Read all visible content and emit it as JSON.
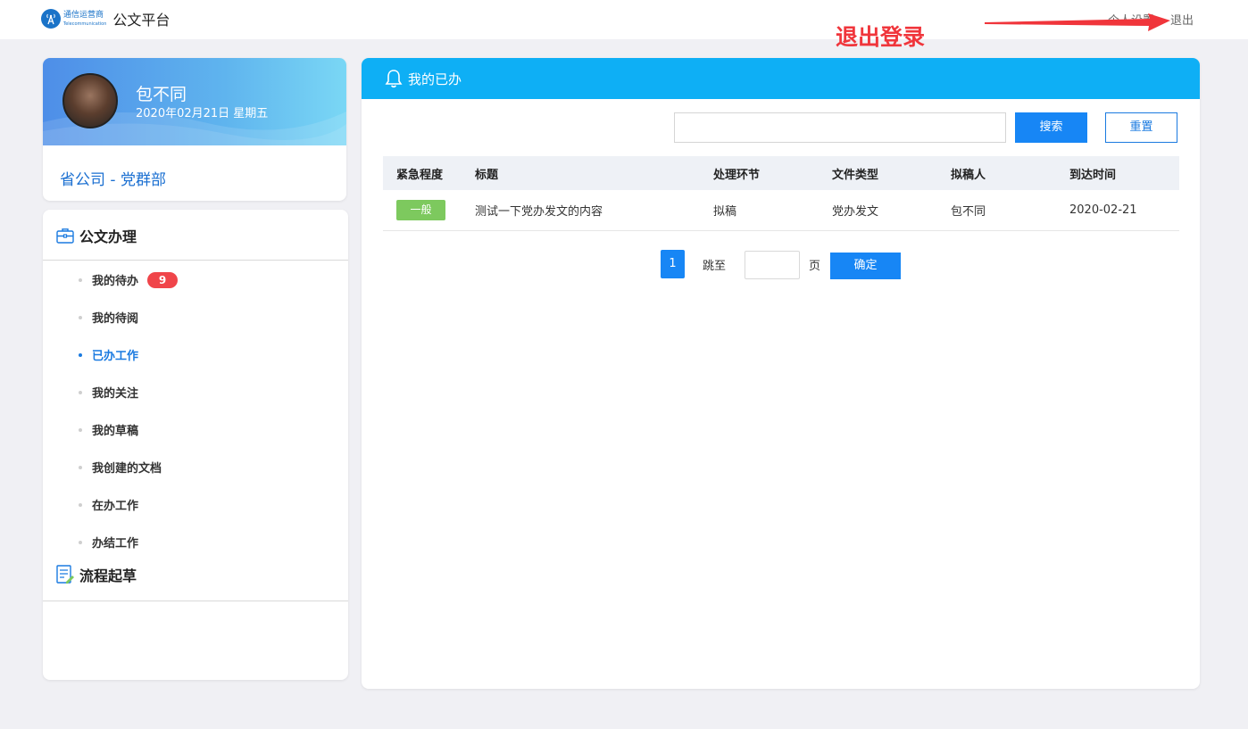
{
  "header": {
    "logo_cn": "通信运营商",
    "logo_en": "Telecommunication",
    "app_title": "公文平台",
    "personal_settings": "个人设置",
    "logout": "退出"
  },
  "annotation": {
    "text": "退出登录",
    "color": "#f0353b"
  },
  "profile": {
    "name": "包不同",
    "date": "2020年02月21日 星期五",
    "org": "省公司 - 党群部"
  },
  "sidebar": {
    "section1_title": "公文办理",
    "items": [
      {
        "label": "我的待办",
        "badge": "9"
      },
      {
        "label": "我的待阅"
      },
      {
        "label": "已办工作",
        "active": true
      },
      {
        "label": "我的关注"
      },
      {
        "label": "我的草稿"
      },
      {
        "label": "我创建的文档"
      },
      {
        "label": "在办工作"
      },
      {
        "label": "办结工作"
      }
    ],
    "section2_title": "流程起草"
  },
  "main": {
    "title": "我的已办",
    "search_placeholder": "",
    "search_button": "搜索",
    "reset_button": "重置",
    "columns": [
      "紧急程度",
      "标题",
      "处理环节",
      "文件类型",
      "拟稿人",
      "到达时间"
    ],
    "rows": [
      {
        "urgency": "一般",
        "title": "测试一下党办发文的内容",
        "stage": "拟稿",
        "doc_type": "党办发文",
        "drafter": "包不同",
        "arrival": "2020-02-21"
      }
    ],
    "pagination": {
      "current_page": "1",
      "jump_label": "跳至",
      "page_unit": "页",
      "confirm": "确定"
    }
  },
  "colors": {
    "primary": "#1786f5",
    "header_bar": "#0eaff5",
    "badge": "#f0454a",
    "tag_normal": "#7dc95e"
  }
}
